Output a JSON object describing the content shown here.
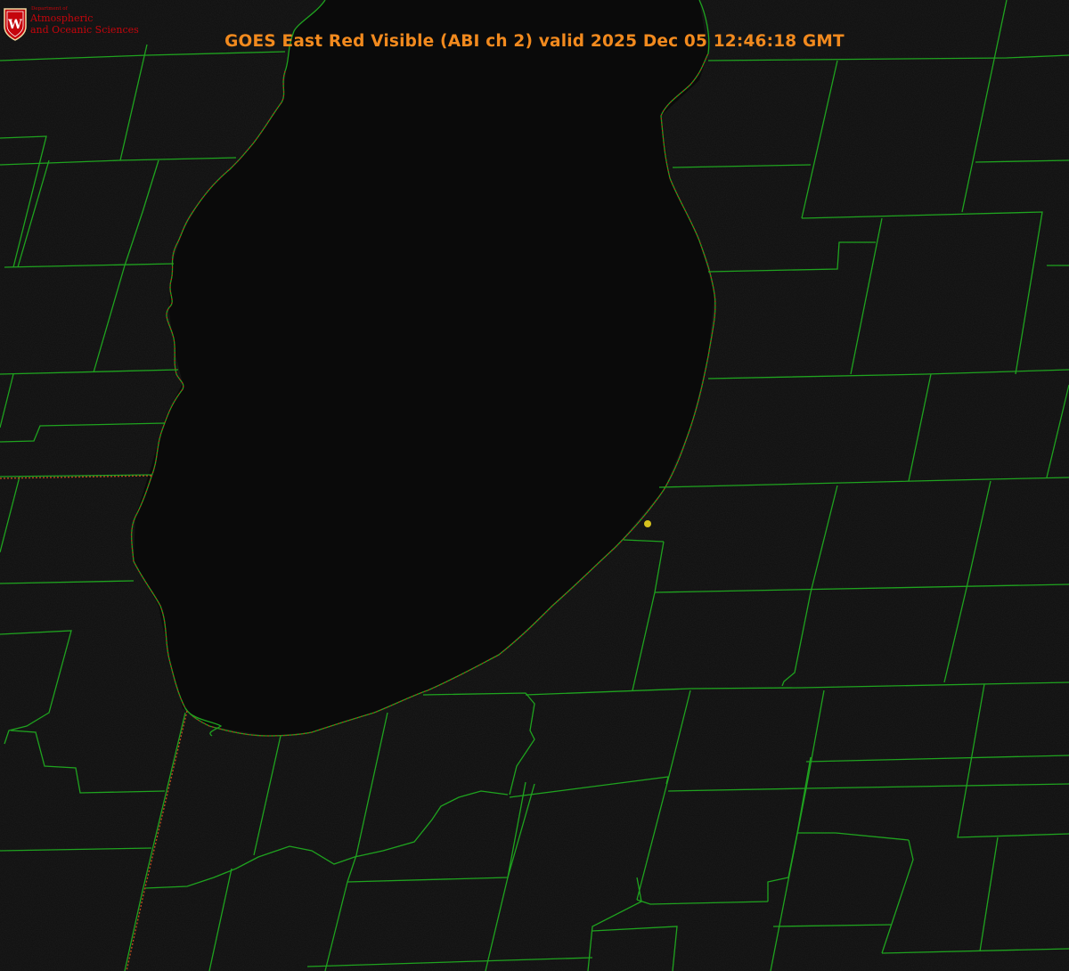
{
  "title": "GOES East Red Visible (ABI ch 2) valid 2025 Dec 05 12:46:18 GMT",
  "logo": {
    "department": "Department of",
    "line1": "Atmospheric",
    "line2": "and Oceanic Sciences",
    "emblem_letter": "W",
    "emblem_color": "#c5050c"
  },
  "colors": {
    "title": "#f28a1e",
    "county_lines": "#1fa31f",
    "state_line": "#b84a1f",
    "shoreline_overlay": "#d21a1a",
    "marker": "#d6c21e",
    "background": "#0f0f0f"
  },
  "map_features": [
    "lake-outline",
    "county-boundaries",
    "state-boundary",
    "location-marker"
  ]
}
